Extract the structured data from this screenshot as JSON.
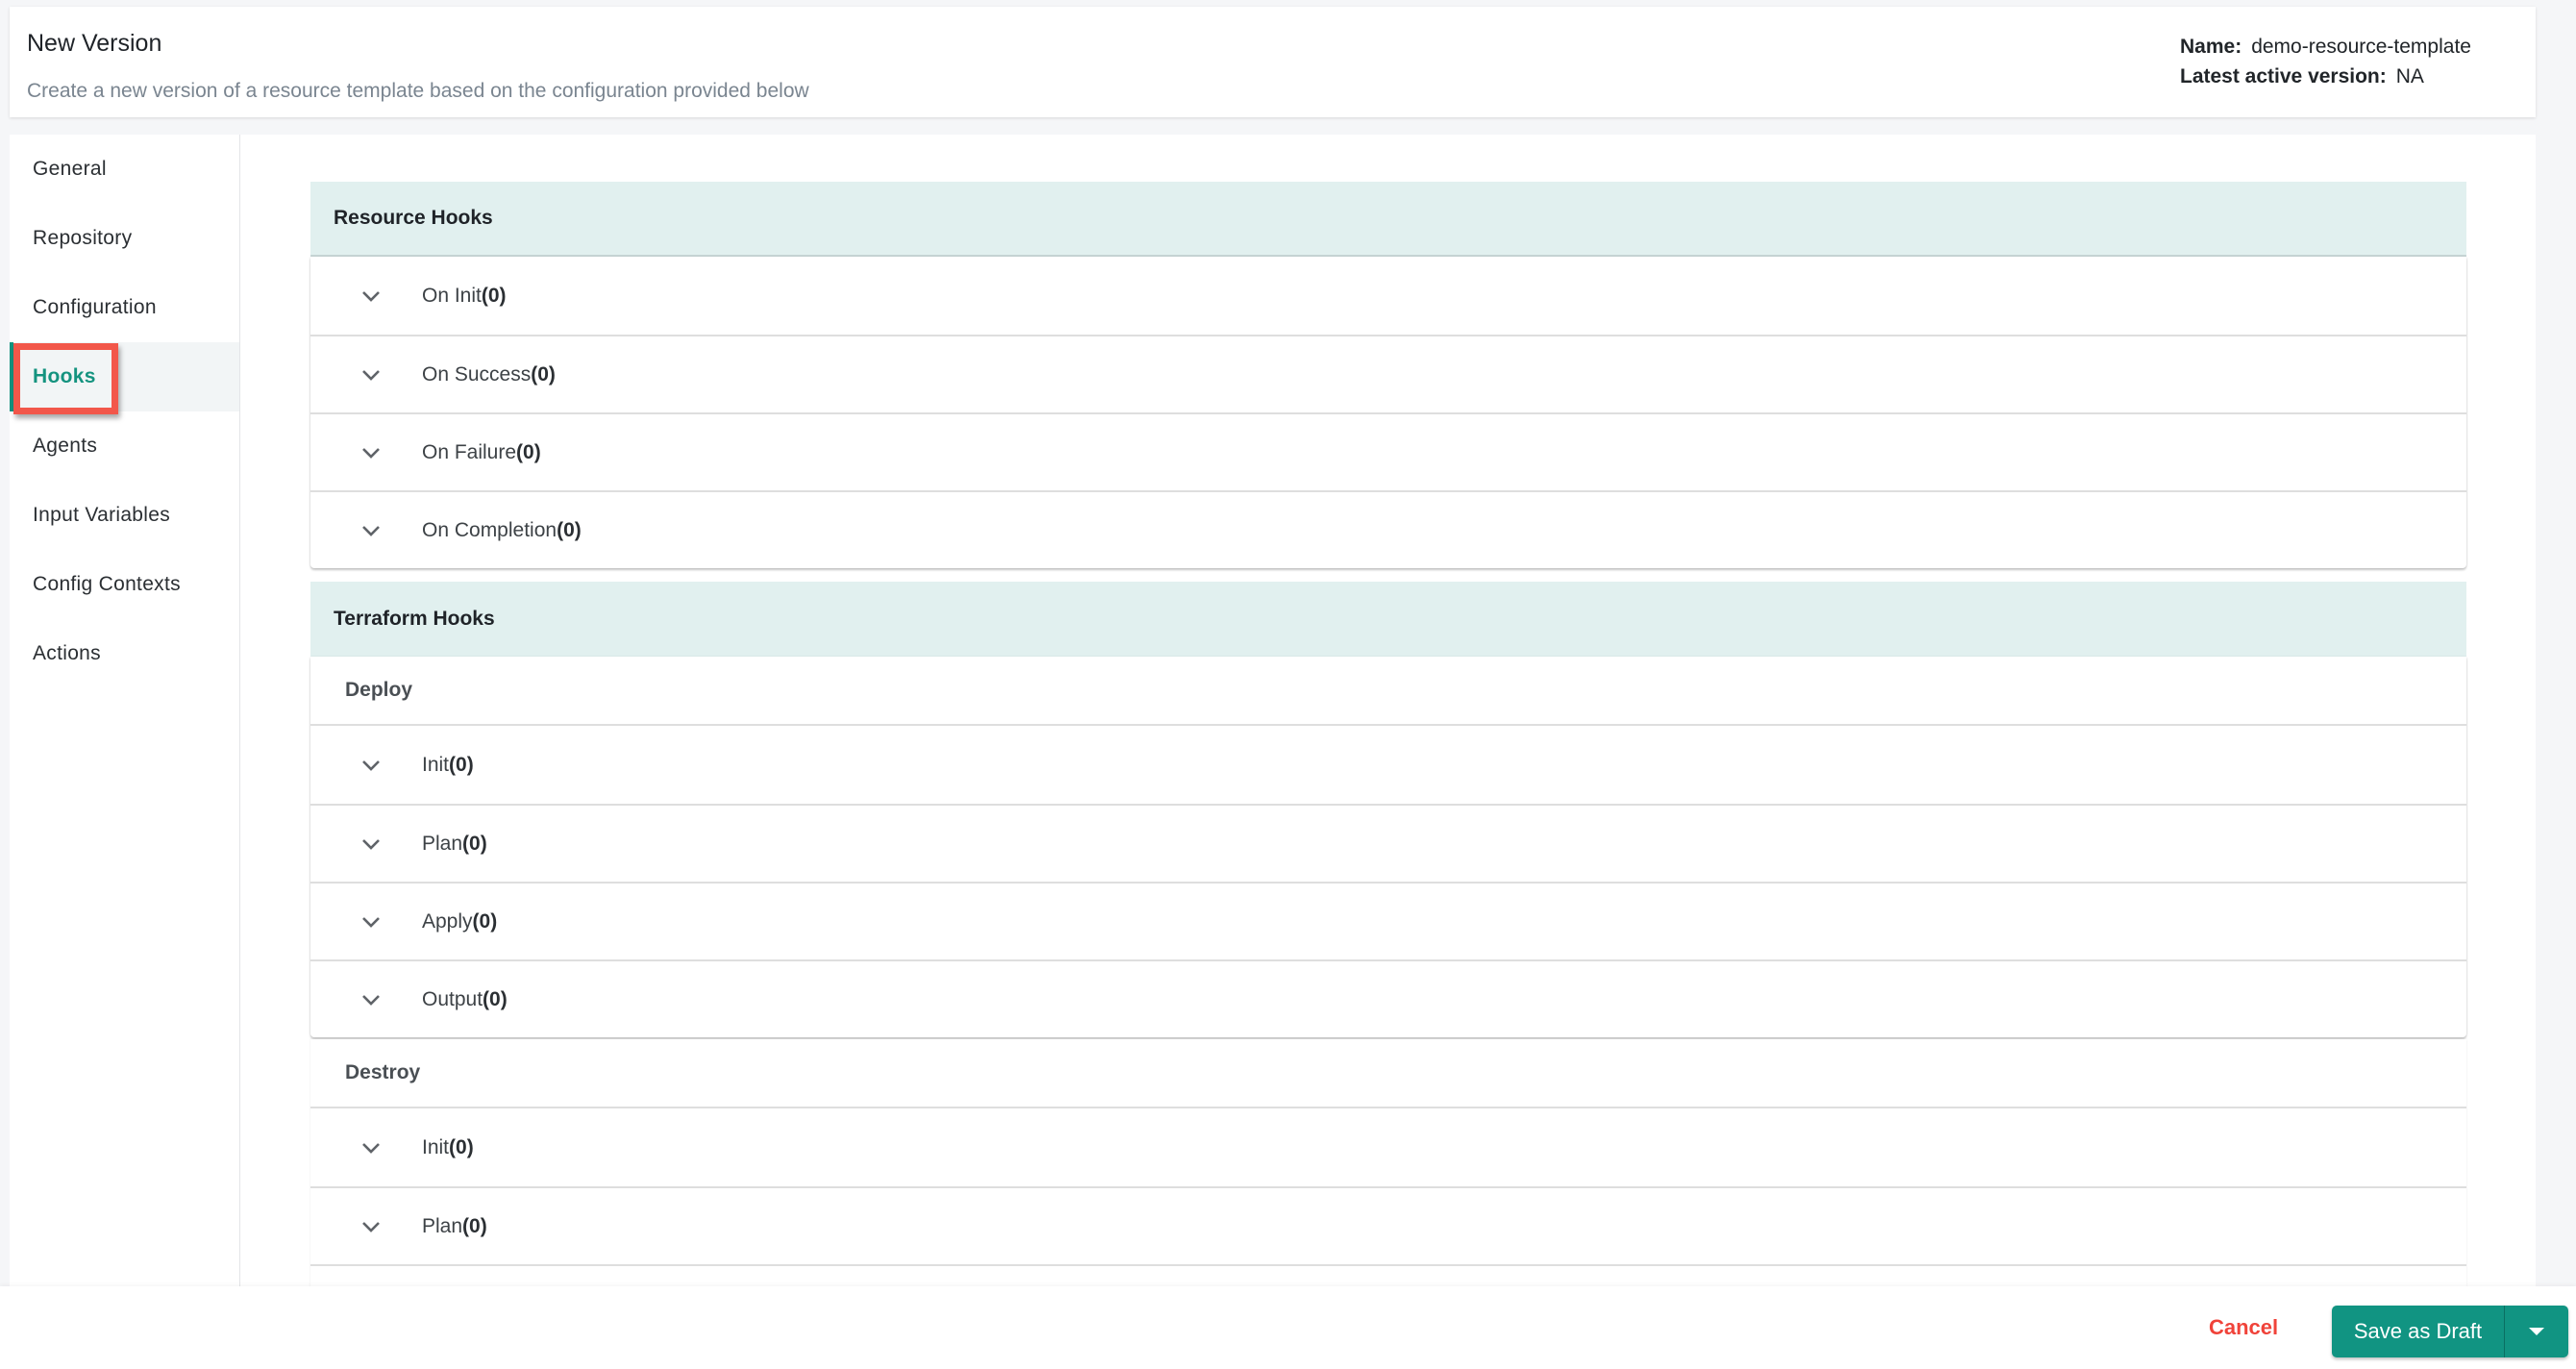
{
  "header": {
    "title": "New Version",
    "subtitle": "Create a new version of a resource template based on the configuration provided below",
    "name_label": "Name:",
    "name_value": "demo-resource-template",
    "latest_label": "Latest active version:",
    "latest_value": "NA"
  },
  "sidebar": {
    "active": "Hooks",
    "items": [
      {
        "label": "General"
      },
      {
        "label": "Repository"
      },
      {
        "label": "Configuration"
      },
      {
        "label": "Hooks"
      },
      {
        "label": "Agents"
      },
      {
        "label": "Input Variables"
      },
      {
        "label": "Config Contexts"
      },
      {
        "label": "Actions"
      }
    ]
  },
  "resource_hooks": {
    "title": "Resource Hooks",
    "rows": [
      {
        "label": "On Init",
        "count": "(0)"
      },
      {
        "label": "On Success",
        "count": "(0)"
      },
      {
        "label": "On Failure",
        "count": "(0)"
      },
      {
        "label": "On Completion",
        "count": "(0)"
      }
    ]
  },
  "terraform_hooks": {
    "title": "Terraform Hooks",
    "deploy": {
      "label": "Deploy",
      "rows": [
        {
          "label": "Init ",
          "count": "(0)"
        },
        {
          "label": "Plan ",
          "count": "(0)"
        },
        {
          "label": "Apply ",
          "count": "(0)"
        },
        {
          "label": "Output ",
          "count": "(0)"
        }
      ]
    },
    "destroy": {
      "label": "Destroy",
      "rows": [
        {
          "label": "Init ",
          "count": "(0)"
        },
        {
          "label": "Plan ",
          "count": "(0)"
        }
      ]
    }
  },
  "footer": {
    "cancel_label": "Cancel",
    "save_label": "Save as Draft"
  },
  "colors": {
    "accent": "#119482",
    "cancel": "#f0433a",
    "section_header_bg": "#e1f0ef",
    "highlight_box": "#f2574a"
  }
}
